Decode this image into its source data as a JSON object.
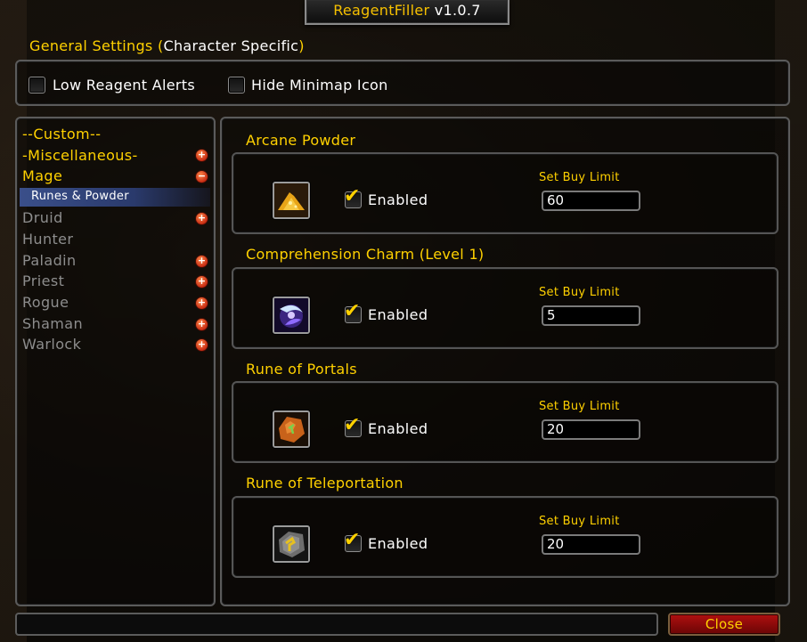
{
  "window": {
    "title_name": "ReagentFiller",
    "title_version": "v1.0.7"
  },
  "general_settings": {
    "title_gold": "General Settings (",
    "title_white": "Character Specific",
    "title_close": ")",
    "low_reagent_alerts_label": "Low Reagent Alerts",
    "low_reagent_alerts_checked": false,
    "hide_minimap_icon_label": "Hide Minimap Icon",
    "hide_minimap_icon_checked": false
  },
  "tree": {
    "items": [
      {
        "label": "--Custom--",
        "color": "#ffd100",
        "toggle": null
      },
      {
        "label": "-Miscellaneous-",
        "color": "#ffd100",
        "toggle": "+"
      },
      {
        "label": "Mage",
        "color": "#ffd100",
        "toggle": "−"
      },
      {
        "label": "Druid",
        "color": "#8d8d8d",
        "toggle": "+"
      },
      {
        "label": "Hunter",
        "color": "#8d8d8d",
        "toggle": null
      },
      {
        "label": "Paladin",
        "color": "#8d8d8d",
        "toggle": "+"
      },
      {
        "label": "Priest",
        "color": "#8d8d8d",
        "toggle": "+"
      },
      {
        "label": "Rogue",
        "color": "#8d8d8d",
        "toggle": "+"
      },
      {
        "label": "Shaman",
        "color": "#8d8d8d",
        "toggle": "+"
      },
      {
        "label": "Warlock",
        "color": "#8d8d8d",
        "toggle": "+"
      }
    ],
    "selected_child": "Runes & Powder"
  },
  "reagents": [
    {
      "name": "Arcane Powder",
      "icon": "arcane-powder-icon",
      "enabled_label": "Enabled",
      "enabled": true,
      "limit_label": "Set Buy Limit",
      "limit": "60"
    },
    {
      "name": "Comprehension Charm (Level 1)",
      "icon": "comprehension-charm-icon",
      "enabled_label": "Enabled",
      "enabled": true,
      "limit_label": "Set Buy Limit",
      "limit": "5"
    },
    {
      "name": "Rune of Portals",
      "icon": "rune-of-portals-icon",
      "enabled_label": "Enabled",
      "enabled": true,
      "limit_label": "Set Buy Limit",
      "limit": "20"
    },
    {
      "name": "Rune of Teleportation",
      "icon": "rune-of-teleportation-icon",
      "enabled_label": "Enabled",
      "enabled": true,
      "limit_label": "Set Buy Limit",
      "limit": "20"
    }
  ],
  "footer": {
    "close_label": "Close",
    "status_text": ""
  },
  "colors": {
    "accent_gold": "#ffd100",
    "disabled_grey": "#8d8d8d",
    "selection_blue": "#3a4f8a",
    "close_red": "#b01010"
  }
}
